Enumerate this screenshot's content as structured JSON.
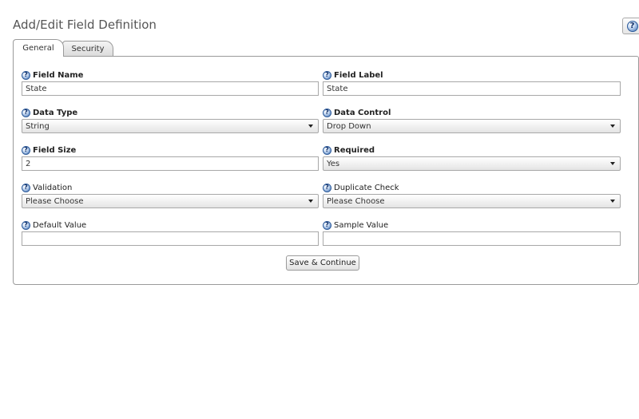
{
  "page_title": "Add/Edit Field Definition",
  "help_icon": "question-mark-help",
  "tabs": [
    {
      "label": "General",
      "active": true
    },
    {
      "label": "Security",
      "active": false
    }
  ],
  "fields": {
    "field_name": {
      "label": "Field Name",
      "value": "State"
    },
    "field_label": {
      "label": "Field Label",
      "value": "State"
    },
    "data_type": {
      "label": "Data Type",
      "value": "String"
    },
    "data_control": {
      "label": "Data Control",
      "value": "Drop Down"
    },
    "field_size": {
      "label": "Field Size",
      "value": "2"
    },
    "required": {
      "label": "Required",
      "value": "Yes"
    },
    "validation": {
      "label": "Validation",
      "value": "Please Choose"
    },
    "duplicate_check": {
      "label": "Duplicate Check",
      "value": "Please Choose"
    },
    "default_value": {
      "label": "Default Value",
      "value": ""
    },
    "sample_value": {
      "label": "Sample Value",
      "value": ""
    }
  },
  "save_button": "Save & Continue"
}
